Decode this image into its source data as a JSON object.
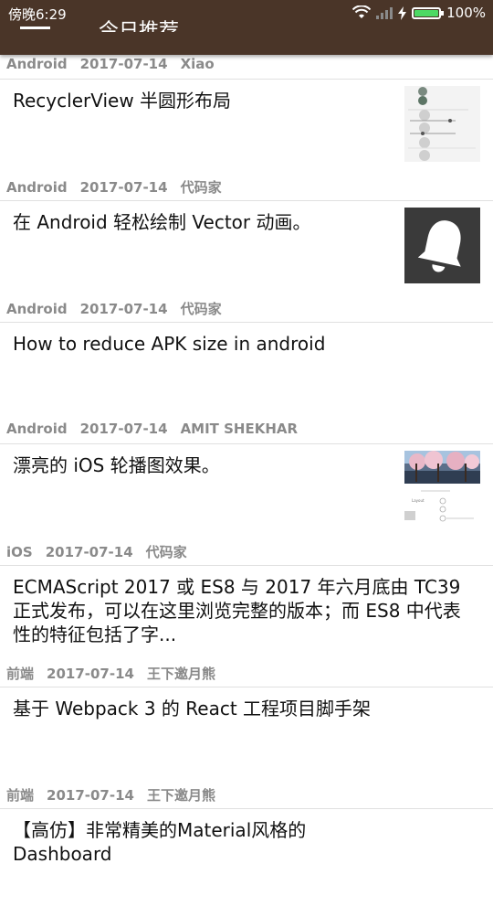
{
  "status_bar": {
    "time": "傍晚6:29",
    "battery": "100%"
  },
  "toolbar": {
    "title": "今日推荐"
  },
  "feed": [
    {
      "category": "Android",
      "date": "2017-07-14",
      "author": "Xiao",
      "title": "RecyclerView 半圆形布局",
      "thumbnail": "settings-ui-thumbnail"
    },
    {
      "category": "Android",
      "date": "2017-07-14",
      "author": "代码家",
      "title": "在 Android 轻松绘制 Vector 动画。",
      "thumbnail": "bell-thumbnail"
    },
    {
      "category": "Android",
      "date": "2017-07-14",
      "author": "代码家",
      "title": "How to reduce APK size in android"
    },
    {
      "category": "Android",
      "date": "2017-07-14",
      "author": "AMIT SHEKHAR",
      "title": "漂亮的 iOS 轮播图效果。",
      "thumbnail": "carousel-photo-thumbnail"
    },
    {
      "category": "iOS",
      "date": "2017-07-14",
      "author": "代码家",
      "title": "ECMAScript 2017 或 ES8 与 2017 年六月底由 TC39 正式发布，可以在这里浏览完整的版本；而 ES8 中代表性的特征包括了字..."
    },
    {
      "category": "前端",
      "date": "2017-07-14",
      "author": "王下邀月熊",
      "title": "基于 Webpack 3 的 React 工程项目脚手架"
    },
    {
      "category": "前端",
      "date": "2017-07-14",
      "author": "王下邀月熊",
      "title": "【高仿】非常精美的Material风格的Dashboard"
    }
  ],
  "colors": {
    "appbar": "#4a3528",
    "meta": "#8a8a8a",
    "divider": "#e0e0e0"
  }
}
